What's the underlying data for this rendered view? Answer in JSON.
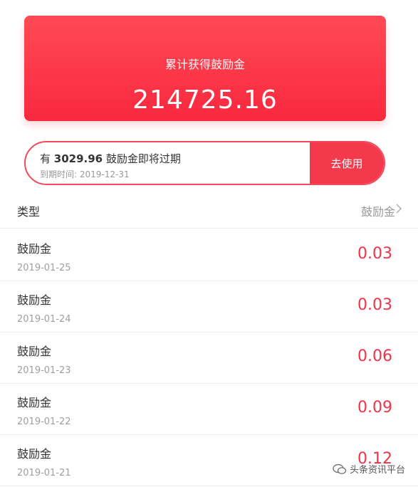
{
  "summary": {
    "title": "累计获得鼓励金",
    "amount": "214725.16"
  },
  "expiry": {
    "prefix": "有 ",
    "amount": "3029.96",
    "suffix": " 鼓励金即将过期",
    "date_text": "到期时间:  2019-12-31",
    "button": "去使用"
  },
  "list_header": {
    "type_label": "类型",
    "filter_label": "鼓励金",
    "chevron_icon": "chevron-right-icon"
  },
  "rows": [
    {
      "name": "鼓励金",
      "date": "2019-01-25",
      "amount": "0.03"
    },
    {
      "name": "鼓励金",
      "date": "2019-01-24",
      "amount": "0.03"
    },
    {
      "name": "鼓励金",
      "date": "2019-01-23",
      "amount": "0.06"
    },
    {
      "name": "鼓励金",
      "date": "2019-01-22",
      "amount": "0.09"
    },
    {
      "name": "鼓励金",
      "date": "2019-01-21",
      "amount": "0.12"
    }
  ],
  "watermark": {
    "text": "头条资讯平台",
    "icon": "wechat-icon"
  },
  "colors": {
    "accent": "#f3394c",
    "card_top": "#ff4a55",
    "card_bottom": "#f9283e",
    "amount": "#f1334a"
  }
}
